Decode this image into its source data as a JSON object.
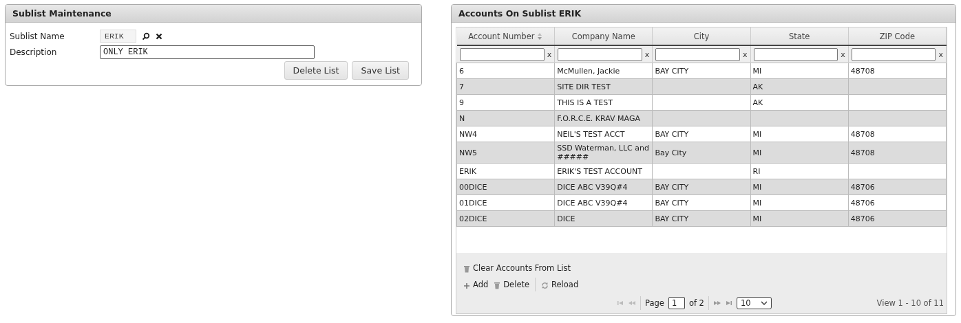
{
  "sublist_panel": {
    "title": "Sublist Maintenance",
    "fields": [
      {
        "label": "Sublist Name",
        "value": "ERIK",
        "kind": "lookup"
      },
      {
        "label": "Description",
        "value": "ONLY ERIK",
        "kind": "text"
      }
    ],
    "buttons": [
      "Delete List",
      "Save List"
    ]
  },
  "accounts_panel": {
    "title": "Accounts On Sublist ERIK",
    "columns": [
      {
        "label": "Account Number",
        "sortable": true,
        "filter_clear": "x"
      },
      {
        "label": "Company Name",
        "sortable": false,
        "filter_clear": "x"
      },
      {
        "label": "City",
        "sortable": false,
        "filter_clear": "x"
      },
      {
        "label": "State",
        "sortable": false,
        "filter_clear": "x"
      },
      {
        "label": "ZIP Code",
        "sortable": false,
        "filter_clear": "x"
      }
    ],
    "rows": [
      [
        "6",
        "McMullen, Jackie",
        "BAY CITY",
        "MI",
        "48708"
      ],
      [
        "7",
        "SITE DIR TEST",
        "",
        "AK",
        ""
      ],
      [
        "9",
        "THIS IS A TEST",
        "",
        "AK",
        ""
      ],
      [
        "N",
        "F.O.R.C.E. KRAV MAGA",
        "",
        "",
        ""
      ],
      [
        "NW4",
        "NEIL'S TEST ACCT",
        "BAY CITY",
        "MI",
        "48708"
      ],
      [
        "NW5",
        "SSD Waterman, LLC and #####",
        "Bay City",
        "MI",
        "48708"
      ],
      [
        "ERIK",
        "ERIK'S TEST ACCOUNT",
        "",
        "RI",
        ""
      ],
      [
        "00DICE",
        "DICE ABC V39Q#4",
        "BAY CITY",
        "MI",
        "48706"
      ],
      [
        "01DICE",
        "DICE ABC V39Q#4",
        "BAY CITY",
        "MI",
        "48706"
      ],
      [
        "02DICE",
        "DICE",
        "BAY CITY",
        "MI",
        "48706"
      ]
    ],
    "clear_action": "Clear Accounts From List",
    "toolbar": [
      {
        "label": "Add",
        "kind": "add"
      },
      {
        "label": "Delete",
        "kind": "delete"
      },
      {
        "label": "Reload",
        "kind": "reload"
      }
    ],
    "pager": {
      "page_label": "Page",
      "page": "1",
      "of_label": "of 2",
      "page_size": "10",
      "summary": "View 1 - 10 of 11"
    }
  }
}
